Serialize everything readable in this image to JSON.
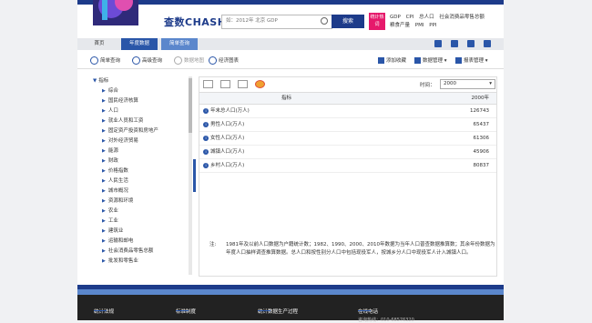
{
  "header": {
    "logo": "查数CHASHU",
    "search_placeholder": "如：2012年 北京 GDP",
    "search_button": "搜索",
    "hot_badge": "统计热词",
    "hot_words": [
      "GDP",
      "CPI",
      "总人口",
      "社会消费品零售总额",
      "粮食产量",
      "PMI",
      "PPI"
    ]
  },
  "nav": {
    "home": "首页",
    "annual": "年度数据",
    "quarterly": "简单查询"
  },
  "toolbar": {
    "simple_query": "简单查询",
    "advanced_query": "高级查询",
    "data_map": "数据地图",
    "econ_chart": "经济图表",
    "add_favorite": "添加收藏",
    "data_manage": "数据管理",
    "report_manage": "报表管理"
  },
  "sidebar": {
    "root": "指标",
    "items": [
      "综合",
      "国民经济核算",
      "人口",
      "就业人员和工资",
      "固定资产投资和房地产",
      "对外经济贸易",
      "能源",
      "财政",
      "价格指数",
      "人民生活",
      "城市概况",
      "资源和环境",
      "农业",
      "工业",
      "建筑业",
      "运输和邮电",
      "社会消费品零售总额",
      "批发和零售业"
    ]
  },
  "content": {
    "time_label": "时间：",
    "time_value": "2000",
    "col_indicator": "指标",
    "col_year": "2000年",
    "rows": [
      {
        "name": "年末总人口(万人)",
        "value": "126743"
      },
      {
        "name": "男性人口(万人)",
        "value": "65437"
      },
      {
        "name": "女性人口(万人)",
        "value": "61306"
      },
      {
        "name": "城镇人口(万人)",
        "value": "45906"
      },
      {
        "name": "乡村人口(万人)",
        "value": "80837"
      }
    ],
    "note_label": "注:",
    "note_text": "1981年及以前人口数据为户籍统计数；1982、1990、2000、2010年数据为当年人口普查数据推算数；其余年份数据为年度人口抽样调查推算数据。总人口和按性别分人口中包括现役军人，按城乡分人口中现役军人计入城镇人口。"
  },
  "footer": {
    "links": [
      "统计法规",
      "标准制度",
      "统计数据生产过程",
      "在线电话"
    ],
    "phone": "咨询热线：010-68576320"
  },
  "colors": {
    "brand": "#1d3b8a",
    "accent": "#2a56a8",
    "badge": "#e6196b"
  }
}
